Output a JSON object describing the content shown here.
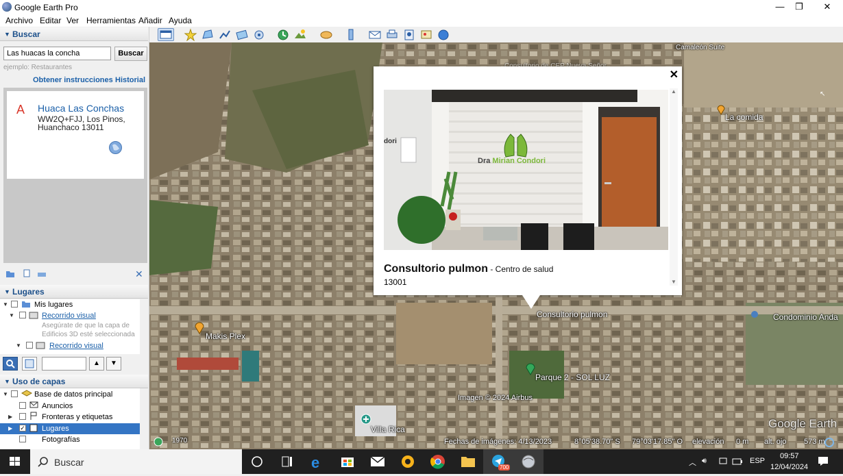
{
  "window": {
    "title": "Google Earth Pro",
    "minimize": "—",
    "maximize": "❐",
    "close": "✕"
  },
  "menu": [
    "Archivo",
    "Editar",
    "Ver",
    "Herramientas",
    "Añadir",
    "Ayuda"
  ],
  "search": {
    "section": "Buscar",
    "query": "Las huacas la concha",
    "button": "Buscar",
    "example": "ejemplo: Restaurantes",
    "directions": "Obtener instrucciones",
    "history": "Historial",
    "result": {
      "marker": "A",
      "title": "Huaca Las Conchas",
      "addr1": "WW2Q+FJJ, Los Pinos,",
      "addr2": "Huanchaco 13011"
    }
  },
  "places": {
    "section": "Lugares",
    "items": [
      {
        "label": "Mis lugares"
      },
      {
        "label": "Recorrido visual"
      },
      {
        "label": "Asegúrate de que la capa de"
      },
      {
        "label": "Edificios 3D esté seleccionada"
      },
      {
        "label": "Recorrido visual"
      }
    ]
  },
  "layers": {
    "section": "Uso de capas",
    "items": [
      {
        "label": "Base de datos principal"
      },
      {
        "label": "Anuncios"
      },
      {
        "label": "Fronteras y etiquetas"
      },
      {
        "label": "Lugares"
      },
      {
        "label": "Fotografías"
      }
    ]
  },
  "map": {
    "labels": {
      "camaleon": "Camaleón Suite",
      "lacomida": "La comida",
      "consultorio": "Consultorio pulmon",
      "condominio": "Condominio Anda",
      "makis": "Makis Plex",
      "parque": "Parque 2 - SOL LUZ",
      "villa": "Villa Rica",
      "faint": "Consultorio de CEP Nueva Señor"
    },
    "copyright": "Imagen © 2024 Airbus",
    "watermark": "Google Earth",
    "status": {
      "year": "1970",
      "date": "Fechas de imágenes: 4/13/2023",
      "lat": "8°05'38.70\" S",
      "lon": "79°03'17.85\" O",
      "elev_label": "elevación",
      "elev": "0 m",
      "eye_label": "alt. ojo",
      "eye": "573 m"
    }
  },
  "popup": {
    "title": "Consultorio pulmon",
    "category": " - Centro de salud",
    "zip": "13001",
    "sign_part1": "Dra ",
    "sign_part2": "Mirian ",
    "sign_part3": "Condori",
    "sign_left": "dori",
    "close": "✕"
  },
  "taskbar": {
    "search": "Buscar",
    "telegram_badge": "700",
    "lang": "ESP",
    "time": "09:57",
    "date": "12/04/2024"
  }
}
